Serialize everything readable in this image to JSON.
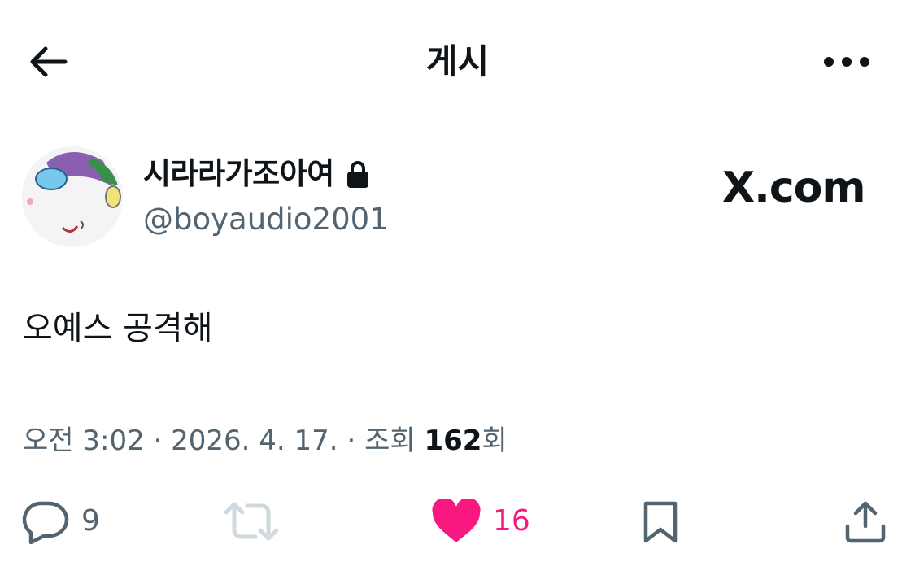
{
  "header": {
    "title": "게시",
    "back_icon": "arrow-left-icon",
    "more_icon": "more-horizontal-icon"
  },
  "author": {
    "display_name": "시라라가조아여",
    "handle": "@boyaudio2001",
    "protected_icon": "lock-icon",
    "avatar_icon": "avatar-image"
  },
  "watermark": {
    "text": "X.com"
  },
  "tweet": {
    "text": "오예스 공격해"
  },
  "meta": {
    "time": "오전 3:02",
    "separator": "·",
    "date": "2026. 4. 17.",
    "views_prefix": "조회",
    "views_count": "162",
    "views_suffix": "회"
  },
  "actions": {
    "reply_count": "9",
    "retweet_count": "",
    "like_count": "16",
    "icons": [
      "reply-icon",
      "retweet-icon",
      "heart-icon",
      "bookmark-icon",
      "share-icon"
    ]
  },
  "colors": {
    "text": "#0f1419",
    "secondary": "#536471",
    "like": "#f91880",
    "disabled": "#cfd9de"
  }
}
